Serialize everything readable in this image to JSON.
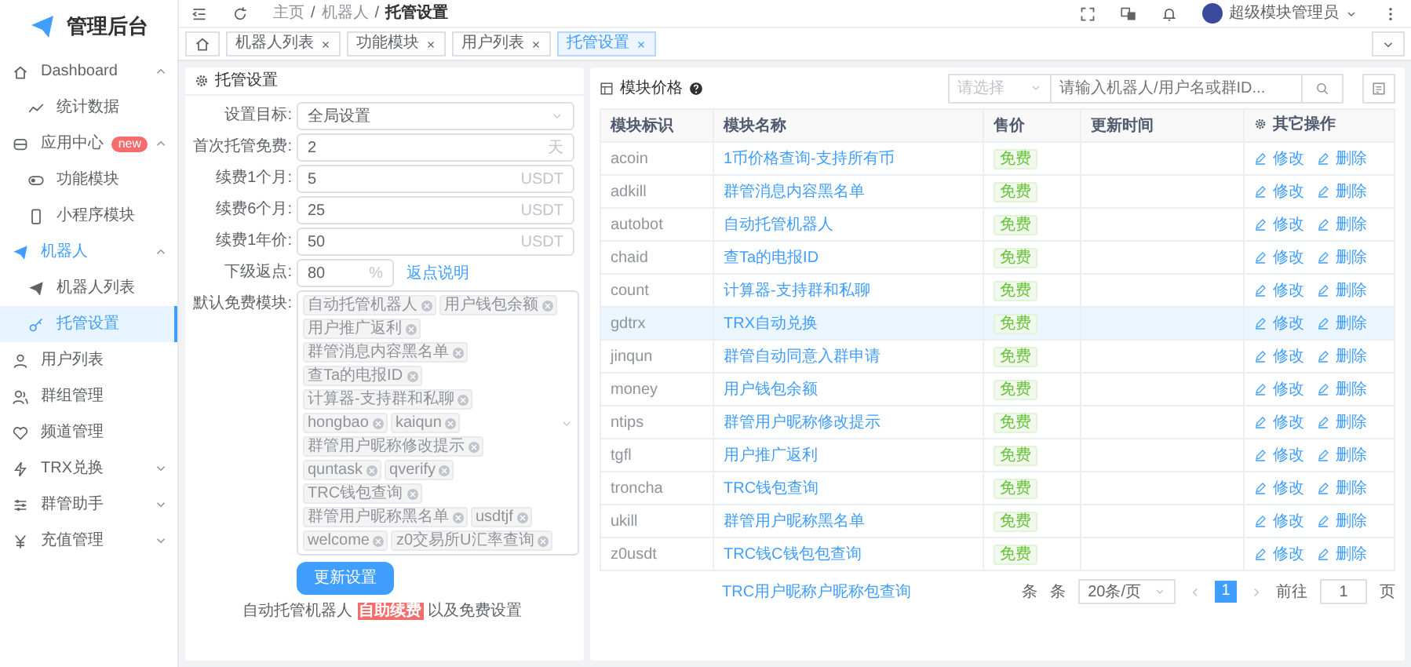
{
  "sidebar": {
    "logo": "管理后台",
    "items": [
      {
        "label": "Dashboard",
        "kind": "group",
        "selected": false,
        "expanded": true,
        "children": [
          {
            "label": "统计数据",
            "selected": false
          }
        ]
      },
      {
        "label": "应用中心",
        "kind": "group",
        "selected": false,
        "expanded": true,
        "badge": "new",
        "children": [
          {
            "label": "功能模块",
            "selected": false
          },
          {
            "label": "小程序模块",
            "selected": false
          }
        ]
      },
      {
        "label": "机器人",
        "kind": "group",
        "selected": true,
        "expanded": true,
        "children": [
          {
            "label": "机器人列表",
            "selected": false
          },
          {
            "label": "托管设置",
            "selected": true
          }
        ]
      },
      {
        "label": "用户列表",
        "kind": "link",
        "selected": false
      },
      {
        "label": "群组管理",
        "kind": "link",
        "selected": false
      },
      {
        "label": "频道管理",
        "kind": "link",
        "selected": false
      },
      {
        "label": "TRX兑换",
        "kind": "group",
        "selected": false,
        "expanded": false
      },
      {
        "label": "群管助手",
        "kind": "group",
        "selected": false,
        "expanded": false
      },
      {
        "label": "充值管理",
        "kind": "group",
        "selected": false,
        "expanded": false
      }
    ]
  },
  "topbar": {
    "breadcrumb": [
      "主页",
      "机器人",
      "托管设置"
    ],
    "breadcrumb_separator": "/",
    "user": "超级模块管理员"
  },
  "tabs": [
    {
      "label": "机器人列表",
      "selected": false
    },
    {
      "label": "功能模块",
      "selected": false
    },
    {
      "label": "用户列表",
      "selected": false
    },
    {
      "label": "托管设置",
      "selected": true
    }
  ],
  "settings": {
    "title": "托管设置",
    "fields": [
      {
        "label": "设置目标:",
        "kind": "select",
        "value": "全局设置"
      },
      {
        "label": "首次托管免费:",
        "kind": "input",
        "value": "2",
        "suffix": "天"
      },
      {
        "label": "续费1个月:",
        "kind": "input",
        "value": "5",
        "suffix": "USDT"
      },
      {
        "label": "续费6个月:",
        "kind": "input",
        "value": "25",
        "suffix": "USDT"
      },
      {
        "label": "续费1年价:",
        "kind": "input",
        "value": "50",
        "suffix": "USDT"
      },
      {
        "label": "下级返点:",
        "kind": "short",
        "value": "80",
        "suffix": "%",
        "link": "返点说明"
      }
    ],
    "modules_label": "默认免费模块:",
    "modules": [
      "自动托管机器人",
      "用户钱包余额",
      "用户推广返利",
      "群管消息内容黑名单",
      "查Ta的电报ID",
      "计算器-支持群和私聊",
      "hongbao",
      "kaiqun",
      "群管用户昵称修改提示",
      "quntask",
      "qverify",
      "TRC钱包查询",
      "群管用户昵称黑名单",
      "usdtjf",
      "welcome",
      "z0交易所U汇率查询"
    ],
    "button": "更新设置",
    "note": "自动托管机器人 **自助续费** 以及免费设置"
  },
  "prices": {
    "title": "模块价格",
    "select_placeholder": "请选择",
    "search_placeholder": "请输入机器人/用户名或群ID...",
    "columns": [
      "模块标识",
      "模块名称",
      "售价",
      "更新时间",
      "其它操作"
    ],
    "rows": [
      {
        "id": "acoin",
        "name": "1币价格查询-支持所有币",
        "price": "免费",
        "highlighted": false,
        "actions": [
          "修改",
          "删除"
        ]
      },
      {
        "id": "adkill",
        "name": "群管消息内容黑名单",
        "price": "免费",
        "highlighted": false,
        "actions": [
          "修改",
          "删除"
        ]
      },
      {
        "id": "autobot",
        "name": "自动托管机器人",
        "price": "免费",
        "highlighted": false,
        "actions": [
          "修改",
          "删除"
        ]
      },
      {
        "id": "chaid",
        "name": "查Ta的电报ID",
        "price": "免费",
        "highlighted": false,
        "actions": [
          "修改",
          "删除"
        ]
      },
      {
        "id": "count",
        "name": "计算器-支持群和私聊",
        "price": "免费",
        "highlighted": false,
        "actions": [
          "修改",
          "删除"
        ]
      },
      {
        "id": "gdtrx",
        "name": "TRX自动兑换",
        "price": "免费",
        "highlighted": true,
        "actions": [
          "修改",
          "删除"
        ]
      },
      {
        "id": "jinqun",
        "name": "群管自动同意入群申请",
        "price": "免费",
        "highlighted": false,
        "actions": [
          "修改",
          "删除"
        ]
      },
      {
        "id": "money",
        "name": "用户钱包余额",
        "price": "免费",
        "highlighted": false,
        "actions": [
          "修改",
          "删除"
        ]
      },
      {
        "id": "ntips",
        "name": "群管用户昵称修改提示",
        "price": "免费",
        "highlighted": false,
        "actions": [
          "修改",
          "删除"
        ]
      },
      {
        "id": "tgfl",
        "name": "用户推广返利",
        "price": "免费",
        "highlighted": false,
        "actions": [
          "修改",
          "删除"
        ]
      },
      {
        "id": "troncha",
        "name": "TRC钱包查询",
        "price": "免费",
        "highlighted": false,
        "actions": [
          "修改",
          "删除"
        ]
      },
      {
        "id": "ukill",
        "name": "群管用户昵称黑名单",
        "price": "免费",
        "highlighted": false,
        "actions": [
          "修改",
          "删除"
        ]
      },
      {
        "id": "z0usdt",
        "name": "TRC钱C钱包包查询",
        "price": "免费",
        "highlighted": false,
        "actions": [
          "修改",
          "删除"
        ]
      }
    ],
    "partial_row": {
      "name": "TRC用户昵称户昵称包查询"
    },
    "pagination": {
      "total_prefix": "条",
      "total_suffix": "条",
      "page_size": "20条/页",
      "pages": [
        {
          "label": "1",
          "selected": true
        }
      ],
      "goto_label": "前往",
      "goto_value": "1",
      "goto_suffix": "页"
    }
  }
}
